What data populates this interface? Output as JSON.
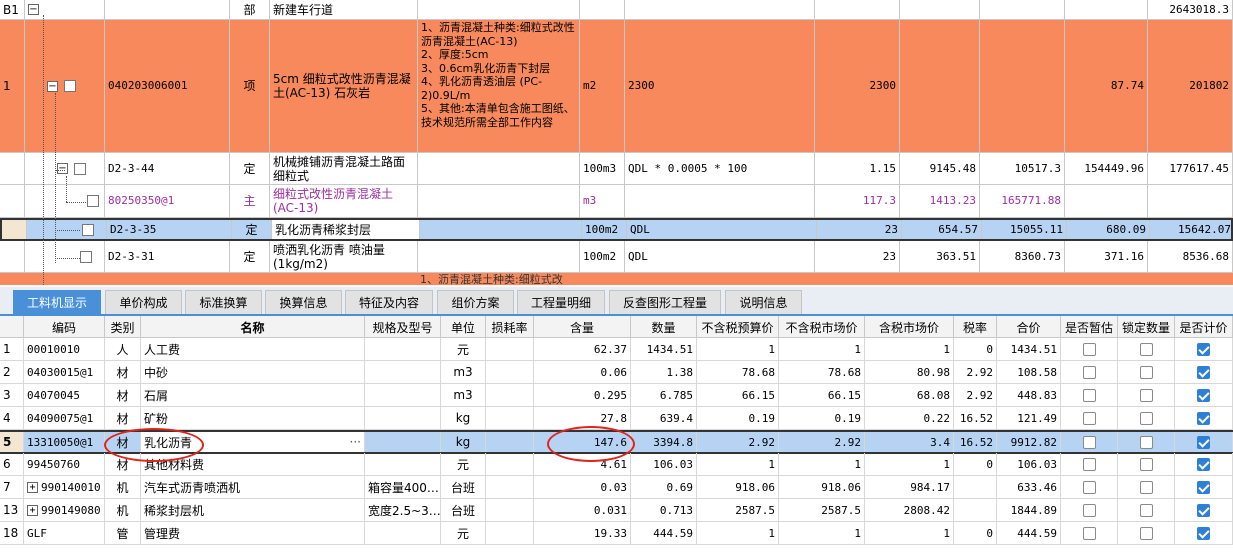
{
  "top": {
    "rowB1": {
      "num": "B1",
      "type": "部",
      "name": "新建车行道",
      "total": "2643018.3"
    },
    "row1": {
      "num": "1",
      "code": "040203006001",
      "type": "项",
      "name": "5cm 细粒式改性沥青混凝土(AC-13) 石灰岩",
      "feature": "1、沥青混凝土种类:细粒式改性沥青混凝土(AC-13)\n2、厚度:5cm\n3、0.6cm乳化沥青下封层\n4、乳化沥青透油层 (PC-2)0.9L/m\n5、其他:本清单包含施工图纸、技术规范所需全部工作内容",
      "unit": "m2",
      "expr": "2300",
      "qty": "2300",
      "price": "87.74",
      "total": "201802"
    },
    "row2": {
      "code": "D2-3-44",
      "type": "定",
      "name": "机械摊铺沥青混凝土路面细粒式",
      "unit": "100m3",
      "expr": "QDL * 0.0005 * 100",
      "qty": "1.15",
      "p1": "9145.48",
      "p2": "10517.3",
      "p3": "154449.96",
      "p4": "177617.45"
    },
    "row3": {
      "code": "80250350@1",
      "type": "主",
      "name": "细粒式改性沥青混凝土(AC-13)",
      "unit": "m3",
      "qty": "117.3",
      "p1": "1413.23",
      "p2": "165771.88"
    },
    "row4": {
      "code": "D2-3-35",
      "type": "定",
      "name": "乳化沥青稀浆封层",
      "unit": "100m2",
      "expr": "QDL",
      "qty": "23",
      "p1": "654.57",
      "p2": "15055.11",
      "p3": "680.09",
      "p4": "15642.07"
    },
    "row5": {
      "code": "D2-3-31",
      "type": "定",
      "name": "喷洒乳化沥青 喷油量(1kg/m2)",
      "unit": "100m2",
      "expr": "QDL",
      "qty": "23",
      "p1": "363.51",
      "p2": "8360.73",
      "p3": "371.16",
      "p4": "8536.68"
    },
    "row6_partial": "1、沥青混凝土种类:细粒式改"
  },
  "tabs": [
    "工料机显示",
    "单价构成",
    "标准换算",
    "换算信息",
    "特征及内容",
    "组价方案",
    "工程量明细",
    "反查图形工程量",
    "说明信息"
  ],
  "headers": [
    "编码",
    "类别",
    "名称",
    "规格及型号",
    "单位",
    "损耗率",
    "含量",
    "数量",
    "不含税预算价",
    "不含税市场价",
    "含税市场价",
    "税率",
    "合价",
    "是否暂估",
    "锁定数量",
    "是否计价"
  ],
  "rows": [
    {
      "n": "1",
      "code": "00010010",
      "type": "人",
      "name": "人工费",
      "spec": "",
      "unit": "元",
      "loss": "",
      "content": "62.37",
      "qty": "1434.51",
      "p1": "1",
      "p2": "1",
      "p3": "1",
      "tax": "0",
      "sum": "1434.51",
      "est": false,
      "lock": false,
      "calc": true
    },
    {
      "n": "2",
      "code": "04030015@1",
      "type": "材",
      "name": "中砂",
      "spec": "",
      "unit": "m3",
      "loss": "",
      "content": "0.06",
      "qty": "1.38",
      "p1": "78.68",
      "p2": "78.68",
      "p3": "80.98",
      "tax": "2.92",
      "sum": "108.58",
      "est": false,
      "lock": false,
      "calc": true
    },
    {
      "n": "3",
      "code": "04070045",
      "type": "材",
      "name": "石屑",
      "spec": "",
      "unit": "m3",
      "loss": "",
      "content": "0.295",
      "qty": "6.785",
      "p1": "66.15",
      "p2": "66.15",
      "p3": "68.08",
      "tax": "2.92",
      "sum": "448.83",
      "est": false,
      "lock": false,
      "calc": true
    },
    {
      "n": "4",
      "code": "04090075@1",
      "type": "材",
      "name": "矿粉",
      "spec": "",
      "unit": "kg",
      "loss": "",
      "content": "27.8",
      "qty": "639.4",
      "p1": "0.19",
      "p2": "0.19",
      "p3": "0.22",
      "tax": "16.52",
      "sum": "121.49",
      "est": false,
      "lock": false,
      "calc": true
    },
    {
      "n": "5",
      "code": "13310050@1",
      "type": "材",
      "name": "乳化沥青",
      "spec": "",
      "unit": "kg",
      "loss": "",
      "content": "147.6",
      "qty": "3394.8",
      "p1": "2.92",
      "p2": "2.92",
      "p3": "3.4",
      "tax": "16.52",
      "sum": "9912.82",
      "est": false,
      "lock": false,
      "calc": true
    },
    {
      "n": "6",
      "code": "99450760",
      "type": "材",
      "name": "其他材料费",
      "spec": "",
      "unit": "元",
      "loss": "",
      "content": "4.61",
      "qty": "106.03",
      "p1": "1",
      "p2": "1",
      "p3": "1",
      "tax": "0",
      "sum": "106.03",
      "est": false,
      "lock": false,
      "calc": true
    },
    {
      "n": "7",
      "code": "990140010",
      "type": "机",
      "name": "汽车式沥青喷洒机",
      "spec": "箱容量400…",
      "unit": "台班",
      "loss": "",
      "content": "0.03",
      "qty": "0.69",
      "p1": "918.06",
      "p2": "918.06",
      "p3": "984.17",
      "tax": "",
      "sum": "633.46",
      "est": false,
      "lock": false,
      "calc": true
    },
    {
      "n": "13",
      "code": "990149080",
      "type": "机",
      "name": "稀浆封层机",
      "spec": "宽度2.5~3…",
      "unit": "台班",
      "loss": "",
      "content": "0.031",
      "qty": "0.713",
      "p1": "2587.5",
      "p2": "2587.5",
      "p3": "2808.42",
      "tax": "",
      "sum": "1844.89",
      "est": false,
      "lock": false,
      "calc": true
    },
    {
      "n": "18",
      "code": "GLF",
      "type": "管",
      "name": "管理费",
      "spec": "",
      "unit": "元",
      "loss": "",
      "content": "19.33",
      "qty": "444.59",
      "p1": "1",
      "p2": "1",
      "p3": "1",
      "tax": "0",
      "sum": "444.59",
      "est": false,
      "lock": false,
      "calc": true
    }
  ],
  "ellipsis": "···"
}
